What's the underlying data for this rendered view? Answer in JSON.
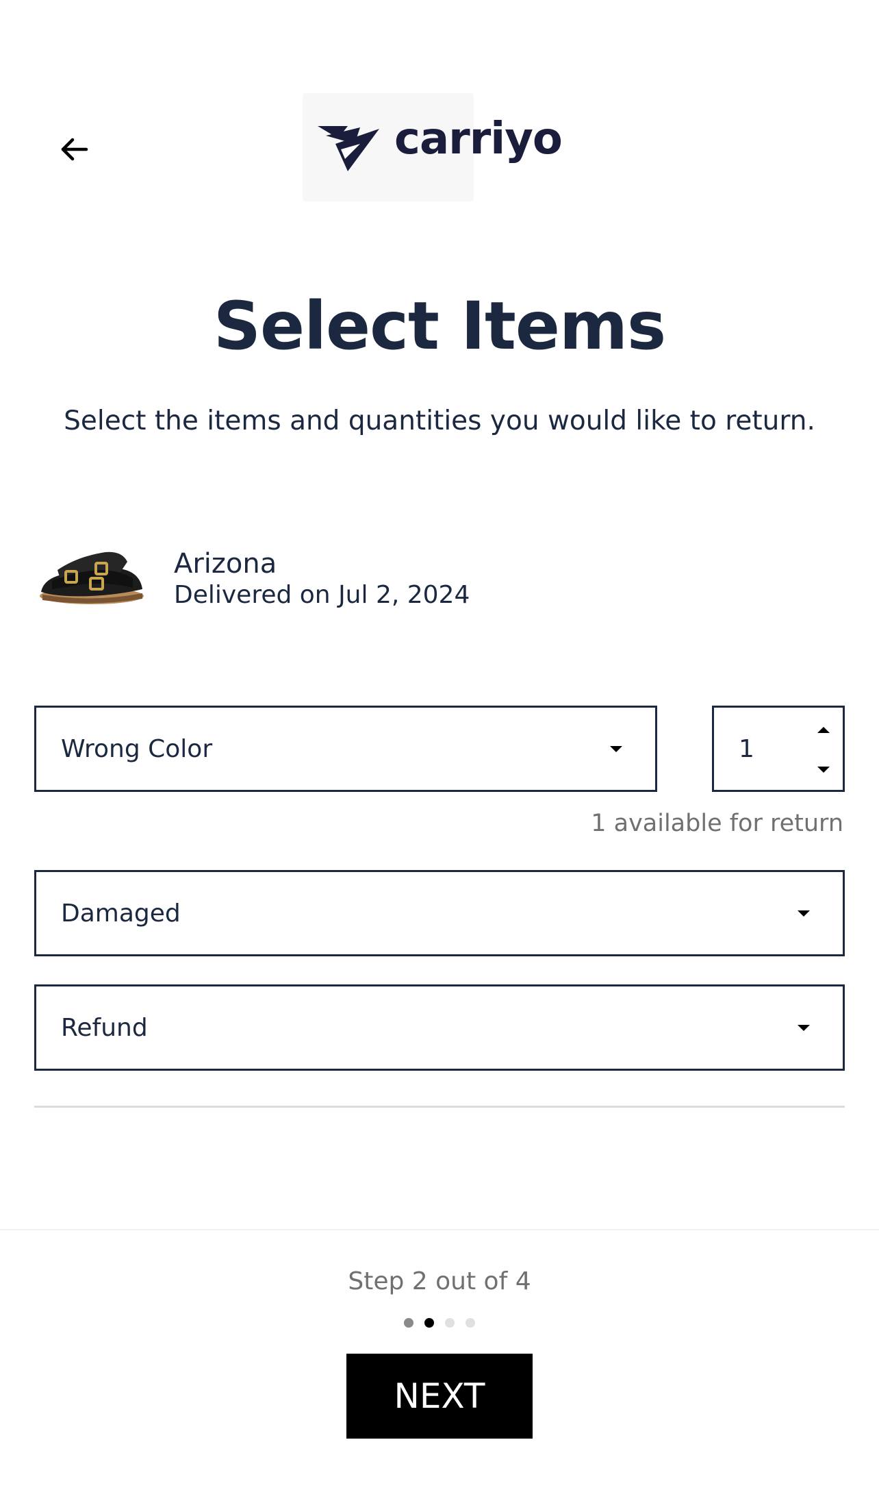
{
  "header": {
    "back_icon": "arrow-left-icon",
    "logo_text": "carriyo",
    "logo_color": "#1b1d3c"
  },
  "page": {
    "title": "Select Items",
    "subtitle": "Select the items and quantities you would like to return."
  },
  "product": {
    "name": "Arizona",
    "delivered": "Delivered on Jul 2, 2024"
  },
  "form": {
    "return_reason": "Wrong Color",
    "quantity": "1",
    "available_text": "1 available for return",
    "sub_reason": "Damaged",
    "resolution": "Refund"
  },
  "footer": {
    "step_text": "Step 2 out of 4",
    "steps_total": 4,
    "current_step": 2,
    "dot_colors": [
      "#8a8a8a",
      "#000000",
      "#e0e0e0",
      "#e0e0e0"
    ],
    "next_label": "NEXT"
  },
  "colors": {
    "primary_text": "#1b2840",
    "muted_text": "#707070",
    "button_bg": "#000000",
    "button_text": "#ffffff"
  }
}
